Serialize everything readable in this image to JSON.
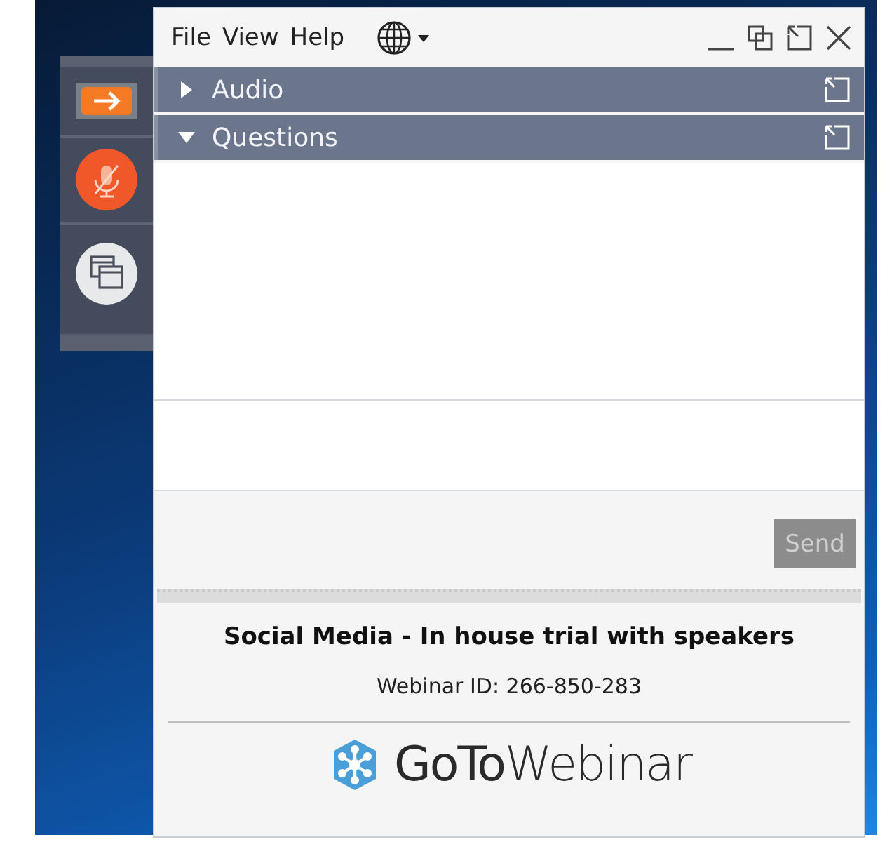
{
  "menu": [
    "File",
    "View",
    "Help"
  ],
  "panels": [
    {
      "title": "Audio",
      "expanded": false
    },
    {
      "title": "Questions",
      "expanded": true
    }
  ],
  "send_button": {
    "label": "Send",
    "disabled": true
  },
  "webinar": {
    "title": "Social Media - In house trial with speakers",
    "id_text": "Webinar ID: 266-850-283"
  },
  "logo": "**GoTo**Webinar"
}
